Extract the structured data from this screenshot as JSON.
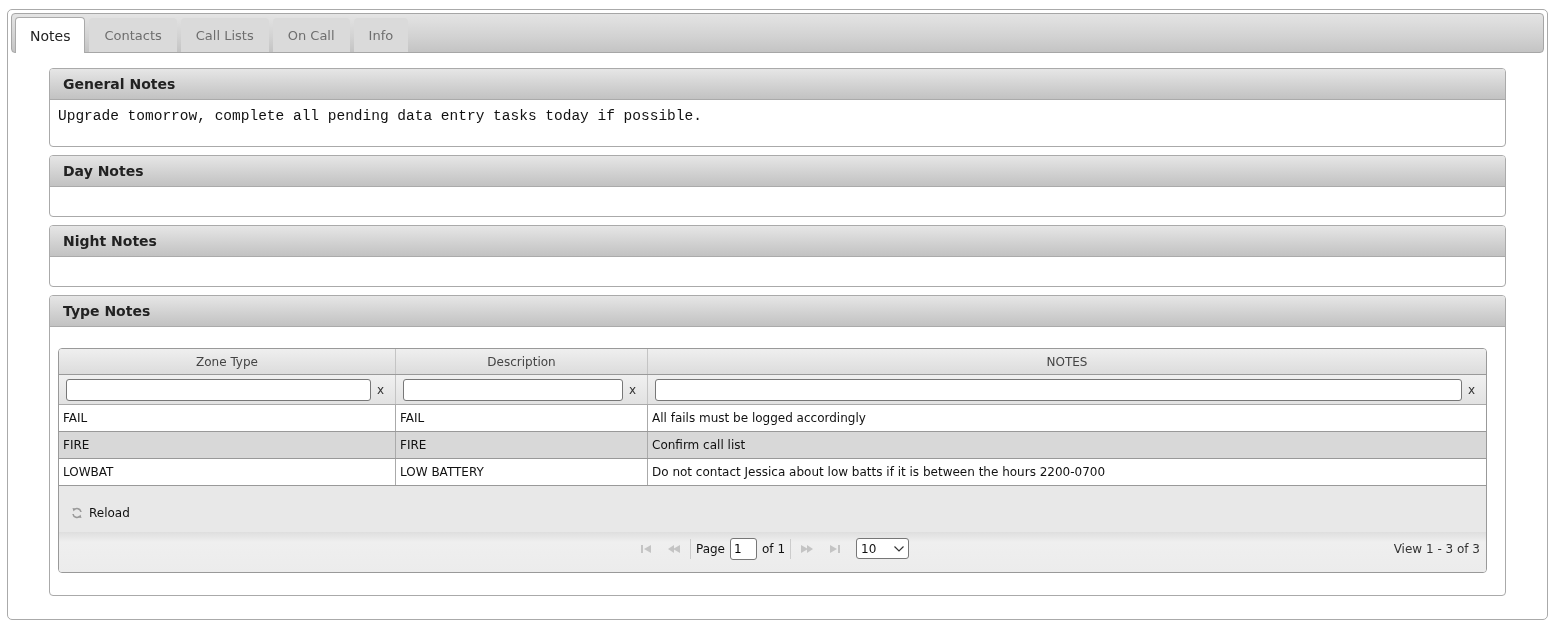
{
  "tabs": [
    {
      "label": "Notes",
      "selected": true
    },
    {
      "label": "Contacts",
      "selected": false
    },
    {
      "label": "Call Lists",
      "selected": false
    },
    {
      "label": "On Call",
      "selected": false
    },
    {
      "label": "Info",
      "selected": false
    }
  ],
  "panels": [
    {
      "title": "General Notes",
      "body": "Upgrade tomorrow, complete all pending data entry tasks today if possible."
    },
    {
      "title": "Day Notes"
    },
    {
      "title": "Night Notes"
    }
  ],
  "type_notes": {
    "title": "Type Notes",
    "table": {
      "columns": [
        {
          "title": "Zone Type",
          "clear": "x"
        },
        {
          "title": "Description",
          "clear": "x"
        },
        {
          "title": "NOTES",
          "clear": "x"
        }
      ],
      "rows": [
        {
          "cells": [
            "FAIL",
            "FAIL",
            "All fails must be logged accordingly"
          ],
          "selected": false
        },
        {
          "cells": [
            "FIRE",
            "FIRE",
            "Confirm call list"
          ],
          "selected": true
        },
        {
          "cells": [
            "LOWBAT",
            "LOW BATTERY",
            "Do not contact Jessica about low batts if it is between the hours 2200-0700"
          ],
          "selected": false
        }
      ]
    },
    "reload": "Reload",
    "pager": {
      "nav_before": [
        {
          "kind": "first",
          "disabled": true
        },
        {
          "kind": "prev",
          "disabled": true
        }
      ],
      "page_label": "Page",
      "page_value": "1",
      "of_label": "of 1",
      "nav_after": [
        {
          "kind": "next",
          "disabled": true
        },
        {
          "kind": "last",
          "disabled": true
        }
      ],
      "page_size": "10",
      "view": "View 1 - 3 of 3"
    }
  }
}
